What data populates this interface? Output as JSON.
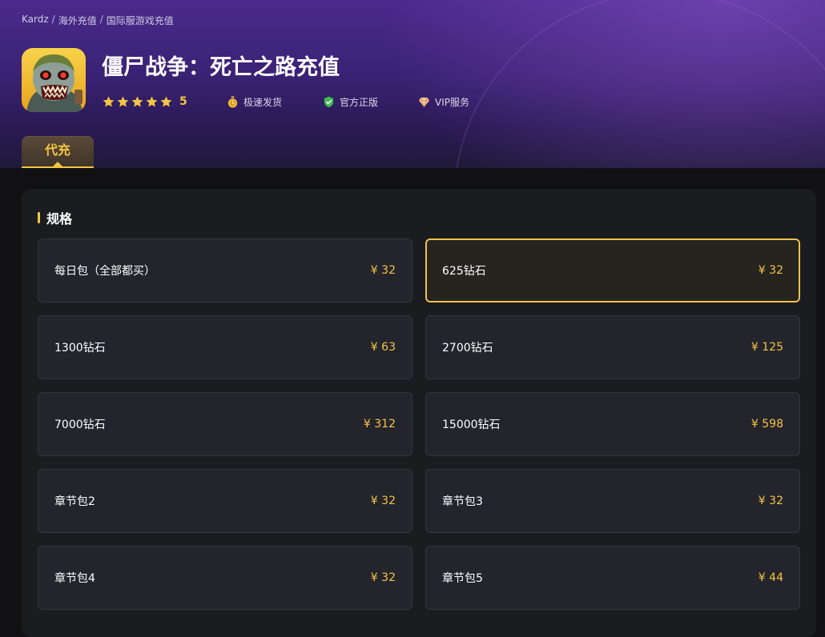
{
  "breadcrumb": [
    "Kardz",
    "海外充值",
    "国际服游戏充值"
  ],
  "product": {
    "title": "僵尸战争：死亡之路充值",
    "rating": "5",
    "features": [
      "极速发货",
      "官方正版",
      "VIP服务"
    ]
  },
  "tabs": [
    {
      "label": "代充",
      "active": true
    }
  ],
  "spec": {
    "title": "规格",
    "currency": "¥",
    "selected_index": 1,
    "items": [
      {
        "name": "每日包（全部都买）",
        "price": "32"
      },
      {
        "name": "625钻石",
        "price": "32"
      },
      {
        "name": "1300钻石",
        "price": "63"
      },
      {
        "name": "2700钻石",
        "price": "125"
      },
      {
        "name": "7000钻石",
        "price": "312"
      },
      {
        "name": "15000钻石",
        "price": "598"
      },
      {
        "name": "章节包2",
        "price": "32"
      },
      {
        "name": "章节包3",
        "price": "32"
      },
      {
        "name": "章节包4",
        "price": "32"
      },
      {
        "name": "章节包5",
        "price": "44"
      }
    ]
  },
  "colors": {
    "accent": "#f5c542",
    "header_gradient_start": "#4a2a8c",
    "page_background": "#111113",
    "card_background": "#23242c"
  },
  "icons": {
    "app": "zombie-game-icon",
    "rating": "star-icon",
    "features": [
      "stopwatch-icon",
      "shield-check-icon",
      "diamond-icon"
    ]
  }
}
